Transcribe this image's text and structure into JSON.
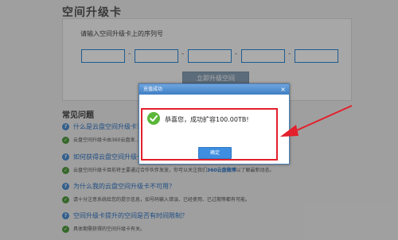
{
  "page": {
    "title": "空间升级卡",
    "serial_label": "请输入空间升级卡上的序列号",
    "dash": "-",
    "upgrade_button": "立即升级空间"
  },
  "faq": {
    "title": "常见问题",
    "items": [
      {
        "type": "q",
        "text": "什么是云盘空间升级卡？"
      },
      {
        "type": "a",
        "text": "云盘空间升级卡由360云盘发..."
      },
      {
        "type": "q",
        "text": "如何获得云盘空间升级卡？"
      },
      {
        "type": "a",
        "text": "云盘空间升级卡目前将主要通过合作伙伴发放，你可以关注我们",
        "highlight": "360云盘微博",
        "suffix": "以了解最新动态。"
      },
      {
        "type": "q",
        "text": "为什么我的云盘空间升级卡不可用？"
      },
      {
        "type": "a",
        "text": "请十分注意系统给您的提示信息，如号码输入错误、已经使用、已过期等都有可能。"
      },
      {
        "type": "q",
        "text": "空间升级卡提升的空间是否有时间限制？"
      },
      {
        "type": "a",
        "text": "具体期需获得的空间升级卡有关。"
      }
    ]
  },
  "dialog": {
    "title": "充值成功",
    "close": "×",
    "message": "恭喜您，成功扩容100.00TB!",
    "confirm_button": "确定"
  },
  "colors": {
    "accent_blue": "#3d8ee0",
    "success_green": "#5bb73a",
    "annotation_red": "#e3202b"
  }
}
